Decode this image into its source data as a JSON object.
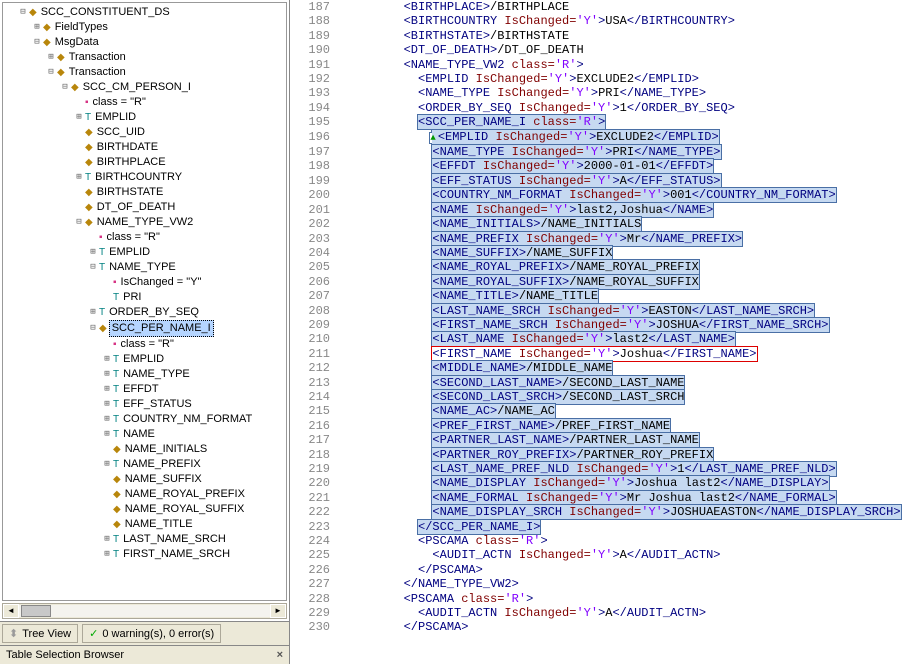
{
  "tree": [
    {
      "indent": 1,
      "exp": "-",
      "icon": "yd",
      "label": "SCC_CONSTITUENT_DS"
    },
    {
      "indent": 2,
      "exp": "+",
      "icon": "yd",
      "label": "FieldTypes"
    },
    {
      "indent": 2,
      "exp": "-",
      "icon": "yd",
      "label": "MsgData"
    },
    {
      "indent": 3,
      "exp": "+",
      "icon": "yd",
      "label": "Transaction"
    },
    {
      "indent": 3,
      "exp": "-",
      "icon": "yd",
      "label": "Transaction"
    },
    {
      "indent": 4,
      "exp": "-",
      "icon": "yd",
      "label": "SCC_CM_PERSON_I"
    },
    {
      "indent": 5,
      "exp": "",
      "icon": "ps",
      "label": "class = \"R\""
    },
    {
      "indent": 5,
      "exp": "+",
      "icon": "tt",
      "label": "EMPLID"
    },
    {
      "indent": 5,
      "exp": "",
      "icon": "yd",
      "label": "SCC_UID"
    },
    {
      "indent": 5,
      "exp": "",
      "icon": "yd",
      "label": "BIRTHDATE"
    },
    {
      "indent": 5,
      "exp": "",
      "icon": "yd",
      "label": "BIRTHPLACE"
    },
    {
      "indent": 5,
      "exp": "+",
      "icon": "tt",
      "label": "BIRTHCOUNTRY"
    },
    {
      "indent": 5,
      "exp": "",
      "icon": "yd",
      "label": "BIRTHSTATE"
    },
    {
      "indent": 5,
      "exp": "",
      "icon": "yd",
      "label": "DT_OF_DEATH"
    },
    {
      "indent": 5,
      "exp": "-",
      "icon": "yd",
      "label": "NAME_TYPE_VW2"
    },
    {
      "indent": 6,
      "exp": "",
      "icon": "ps",
      "label": "class = \"R\""
    },
    {
      "indent": 6,
      "exp": "+",
      "icon": "tt",
      "label": "EMPLID"
    },
    {
      "indent": 6,
      "exp": "-",
      "icon": "tt",
      "label": "NAME_TYPE"
    },
    {
      "indent": 7,
      "exp": "",
      "icon": "ps",
      "label": "IsChanged = \"Y\""
    },
    {
      "indent": 7,
      "exp": "",
      "icon": "tt",
      "label": "PRI"
    },
    {
      "indent": 6,
      "exp": "+",
      "icon": "tt",
      "label": "ORDER_BY_SEQ"
    },
    {
      "indent": 6,
      "exp": "-",
      "icon": "yd",
      "label": "SCC_PER_NAME_I",
      "selected": true
    },
    {
      "indent": 7,
      "exp": "",
      "icon": "ps",
      "label": "class = \"R\""
    },
    {
      "indent": 7,
      "exp": "+",
      "icon": "tt",
      "label": "EMPLID"
    },
    {
      "indent": 7,
      "exp": "+",
      "icon": "tt",
      "label": "NAME_TYPE"
    },
    {
      "indent": 7,
      "exp": "+",
      "icon": "tt",
      "label": "EFFDT"
    },
    {
      "indent": 7,
      "exp": "+",
      "icon": "tt",
      "label": "EFF_STATUS"
    },
    {
      "indent": 7,
      "exp": "+",
      "icon": "tt",
      "label": "COUNTRY_NM_FORMAT"
    },
    {
      "indent": 7,
      "exp": "+",
      "icon": "tt",
      "label": "NAME"
    },
    {
      "indent": 7,
      "exp": "",
      "icon": "yd",
      "label": "NAME_INITIALS"
    },
    {
      "indent": 7,
      "exp": "+",
      "icon": "tt",
      "label": "NAME_PREFIX"
    },
    {
      "indent": 7,
      "exp": "",
      "icon": "yd",
      "label": "NAME_SUFFIX"
    },
    {
      "indent": 7,
      "exp": "",
      "icon": "yd",
      "label": "NAME_ROYAL_PREFIX"
    },
    {
      "indent": 7,
      "exp": "",
      "icon": "yd",
      "label": "NAME_ROYAL_SUFFIX"
    },
    {
      "indent": 7,
      "exp": "",
      "icon": "yd",
      "label": "NAME_TITLE"
    },
    {
      "indent": 7,
      "exp": "+",
      "icon": "tt",
      "label": "LAST_NAME_SRCH"
    },
    {
      "indent": 7,
      "exp": "+",
      "icon": "tt",
      "label": "FIRST_NAME_SRCH"
    }
  ],
  "buttons": {
    "tree_view": "Tree View",
    "warnings": "0 warning(s), 0 error(s)"
  },
  "status": "Table Selection Browser",
  "codeStart": 187,
  "code": [
    {
      "i": 4,
      "t": [
        "BIRTHPLACE",
        "",
        "",
        "/BIRTHPLACE"
      ]
    },
    {
      "i": 4,
      "t": [
        "BIRTHCOUNTRY",
        " IsChanged",
        "'Y'",
        "USA",
        "/BIRTHCOUNTRY"
      ]
    },
    {
      "i": 4,
      "t": [
        "BIRTHSTATE",
        "",
        "",
        "/BIRTHSTATE"
      ]
    },
    {
      "i": 4,
      "t": [
        "DT_OF_DEATH",
        "",
        "",
        "/DT_OF_DEATH"
      ]
    },
    {
      "i": 4,
      "t": [
        "NAME_TYPE_VW2",
        " class",
        "'R'",
        "",
        ""
      ]
    },
    {
      "i": 5,
      "t": [
        "EMPLID",
        " IsChanged",
        "'Y'",
        "EXCLUDE2",
        "/EMPLID"
      ]
    },
    {
      "i": 5,
      "t": [
        "NAME_TYPE",
        " IsChanged",
        "'Y'",
        "PRI",
        "/NAME_TYPE"
      ]
    },
    {
      "i": 5,
      "t": [
        "ORDER_BY_SEQ",
        " IsChanged",
        "'Y'",
        "1",
        "/ORDER_BY_SEQ"
      ]
    },
    {
      "i": 5,
      "hl": 1,
      "t": [
        "SCC_PER_NAME_I",
        " class",
        "'R'",
        "",
        ""
      ]
    },
    {
      "i": 6,
      "hl": 1,
      "tri": 1,
      "t": [
        "EMPLID",
        " IsChanged",
        "'Y'",
        "EXCLUDE2",
        "/EMPLID"
      ]
    },
    {
      "i": 6,
      "hl": 1,
      "t": [
        "NAME_TYPE",
        " IsChanged",
        "'Y'",
        "PRI",
        "/NAME_TYPE"
      ]
    },
    {
      "i": 6,
      "hl": 1,
      "t": [
        "EFFDT",
        " IsChanged",
        "'Y'",
        "2000-01-01",
        "/EFFDT"
      ]
    },
    {
      "i": 6,
      "hl": 1,
      "t": [
        "EFF_STATUS",
        " IsChanged",
        "'Y'",
        "A",
        "/EFF_STATUS"
      ]
    },
    {
      "i": 6,
      "hl": 1,
      "t": [
        "COUNTRY_NM_FORMAT",
        " IsChanged",
        "'Y'",
        "001",
        "/COUNTRY_NM_FORMAT"
      ]
    },
    {
      "i": 6,
      "hl": 1,
      "t": [
        "NAME",
        " IsChanged",
        "'Y'",
        "last2,Joshua",
        "/NAME"
      ]
    },
    {
      "i": 6,
      "hl": 1,
      "t": [
        "NAME_INITIALS",
        "",
        "",
        "/NAME_INITIALS"
      ]
    },
    {
      "i": 6,
      "hl": 1,
      "t": [
        "NAME_PREFIX",
        " IsChanged",
        "'Y'",
        "Mr",
        "/NAME_PREFIX"
      ]
    },
    {
      "i": 6,
      "hl": 1,
      "t": [
        "NAME_SUFFIX",
        "",
        "",
        "/NAME_SUFFIX"
      ]
    },
    {
      "i": 6,
      "hl": 1,
      "t": [
        "NAME_ROYAL_PREFIX",
        "",
        "",
        "/NAME_ROYAL_PREFIX"
      ]
    },
    {
      "i": 6,
      "hl": 1,
      "t": [
        "NAME_ROYAL_SUFFIX",
        "",
        "",
        "/NAME_ROYAL_SUFFIX"
      ]
    },
    {
      "i": 6,
      "hl": 1,
      "t": [
        "NAME_TITLE",
        "",
        "",
        "/NAME_TITLE"
      ]
    },
    {
      "i": 6,
      "hl": 1,
      "t": [
        "LAST_NAME_SRCH",
        " IsChanged",
        "'Y'",
        "EASTON",
        "/LAST_NAME_SRCH"
      ]
    },
    {
      "i": 6,
      "hl": 1,
      "t": [
        "FIRST_NAME_SRCH",
        " IsChanged",
        "'Y'",
        "JOSHUA",
        "/FIRST_NAME_SRCH"
      ]
    },
    {
      "i": 6,
      "hl": 1,
      "t": [
        "LAST_NAME",
        " IsChanged",
        "'Y'",
        "last2",
        "/LAST_NAME"
      ]
    },
    {
      "i": 6,
      "hlr": 1,
      "t": [
        "FIRST_NAME",
        " IsChanged",
        "'Y'",
        "Joshua",
        "/FIRST_NAME"
      ]
    },
    {
      "i": 6,
      "hl": 1,
      "t": [
        "MIDDLE_NAME",
        "",
        "",
        "/MIDDLE_NAME"
      ]
    },
    {
      "i": 6,
      "hl": 1,
      "t": [
        "SECOND_LAST_NAME",
        "",
        "",
        "/SECOND_LAST_NAME"
      ]
    },
    {
      "i": 6,
      "hl": 1,
      "t": [
        "SECOND_LAST_SRCH",
        "",
        "",
        "/SECOND_LAST_SRCH"
      ]
    },
    {
      "i": 6,
      "hl": 1,
      "t": [
        "NAME_AC",
        "",
        "",
        "/NAME_AC"
      ]
    },
    {
      "i": 6,
      "hl": 1,
      "t": [
        "PREF_FIRST_NAME",
        "",
        "",
        "/PREF_FIRST_NAME"
      ]
    },
    {
      "i": 6,
      "hl": 1,
      "t": [
        "PARTNER_LAST_NAME",
        "",
        "",
        "/PARTNER_LAST_NAME"
      ]
    },
    {
      "i": 6,
      "hl": 1,
      "t": [
        "PARTNER_ROY_PREFIX",
        "",
        "",
        "/PARTNER_ROY_PREFIX"
      ]
    },
    {
      "i": 6,
      "hl": 1,
      "t": [
        "LAST_NAME_PREF_NLD",
        " IsChanged",
        "'Y'",
        "1",
        "/LAST_NAME_PREF_NLD"
      ]
    },
    {
      "i": 6,
      "hl": 1,
      "t": [
        "NAME_DISPLAY",
        " IsChanged",
        "'Y'",
        "Joshua last2",
        "/NAME_DISPLAY"
      ]
    },
    {
      "i": 6,
      "hl": 1,
      "t": [
        "NAME_FORMAL",
        " IsChanged",
        "'Y'",
        "Mr Joshua last2",
        "/NAME_FORMAL"
      ]
    },
    {
      "i": 6,
      "hl": 1,
      "t": [
        "NAME_DISPLAY_SRCH",
        " IsChanged",
        "'Y'",
        "JOSHUAEASTON",
        "/NAME_DISPLAY_SRCH"
      ]
    },
    {
      "i": 5,
      "hl": 1,
      "t": [
        "/SCC_PER_NAME_I",
        "",
        "",
        "",
        ""
      ]
    },
    {
      "i": 5,
      "t": [
        "PSCAMA",
        " class",
        "'R'",
        "",
        ""
      ]
    },
    {
      "i": 6,
      "t": [
        "AUDIT_ACTN",
        " IsChanged",
        "'Y'",
        "A",
        "/AUDIT_ACTN"
      ]
    },
    {
      "i": 5,
      "t": [
        "/PSCAMA",
        "",
        "",
        "",
        ""
      ]
    },
    {
      "i": 4,
      "t": [
        "/NAME_TYPE_VW2",
        "",
        "",
        "",
        ""
      ]
    },
    {
      "i": 4,
      "t": [
        "PSCAMA",
        " class",
        "'R'",
        "",
        ""
      ]
    },
    {
      "i": 5,
      "t": [
        "AUDIT_ACTN",
        " IsChanged",
        "'Y'",
        "A",
        "/AUDIT_ACTN"
      ]
    },
    {
      "i": 4,
      "t": [
        "/PSCAMA",
        "",
        "",
        "",
        ""
      ]
    }
  ]
}
